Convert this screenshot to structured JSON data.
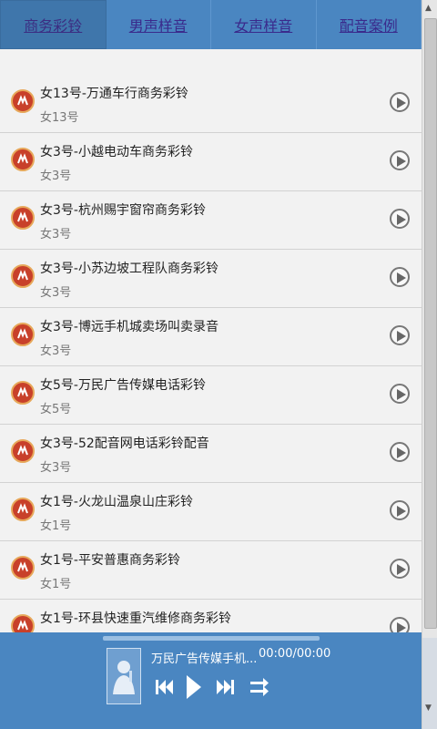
{
  "tabs": [
    {
      "label": "商务彩铃",
      "active": true
    },
    {
      "label": "男声样音",
      "active": false
    },
    {
      "label": "女声样音",
      "active": false
    },
    {
      "label": "配音案例",
      "active": false
    }
  ],
  "items": [
    {
      "title": "女13号-万通车行商务彩铃",
      "sub": "女13号"
    },
    {
      "title": "女3号-小越电动车商务彩铃",
      "sub": "女3号"
    },
    {
      "title": "女3号-杭州赐宇窗帘商务彩铃",
      "sub": "女3号"
    },
    {
      "title": "女3号-小苏边坡工程队商务彩铃",
      "sub": "女3号"
    },
    {
      "title": "女3号-博远手机城卖场叫卖录音",
      "sub": "女3号"
    },
    {
      "title": "女5号-万民广告传媒电话彩铃",
      "sub": "女5号"
    },
    {
      "title": "女3号-52配音网电话彩铃配音",
      "sub": "女3号"
    },
    {
      "title": "女1号-火龙山温泉山庄彩铃",
      "sub": "女1号"
    },
    {
      "title": "女1号-平安普惠商务彩铃",
      "sub": "女1号"
    },
    {
      "title": "女1号-环县快速重汽维修商务彩铃",
      "sub": ""
    }
  ],
  "player": {
    "song": "万民广告传媒手机...",
    "time": "00:00/00:00",
    "progress": 0
  },
  "icons": {
    "logo": "ringtone-logo-icon",
    "play": "play-circle-icon",
    "prev": "previous-icon",
    "play_main": "play-icon",
    "next": "next-icon",
    "shuffle": "shuffle-icon"
  },
  "colors": {
    "bar": "#4a86c1",
    "tab_text": "#3a2a8c"
  }
}
